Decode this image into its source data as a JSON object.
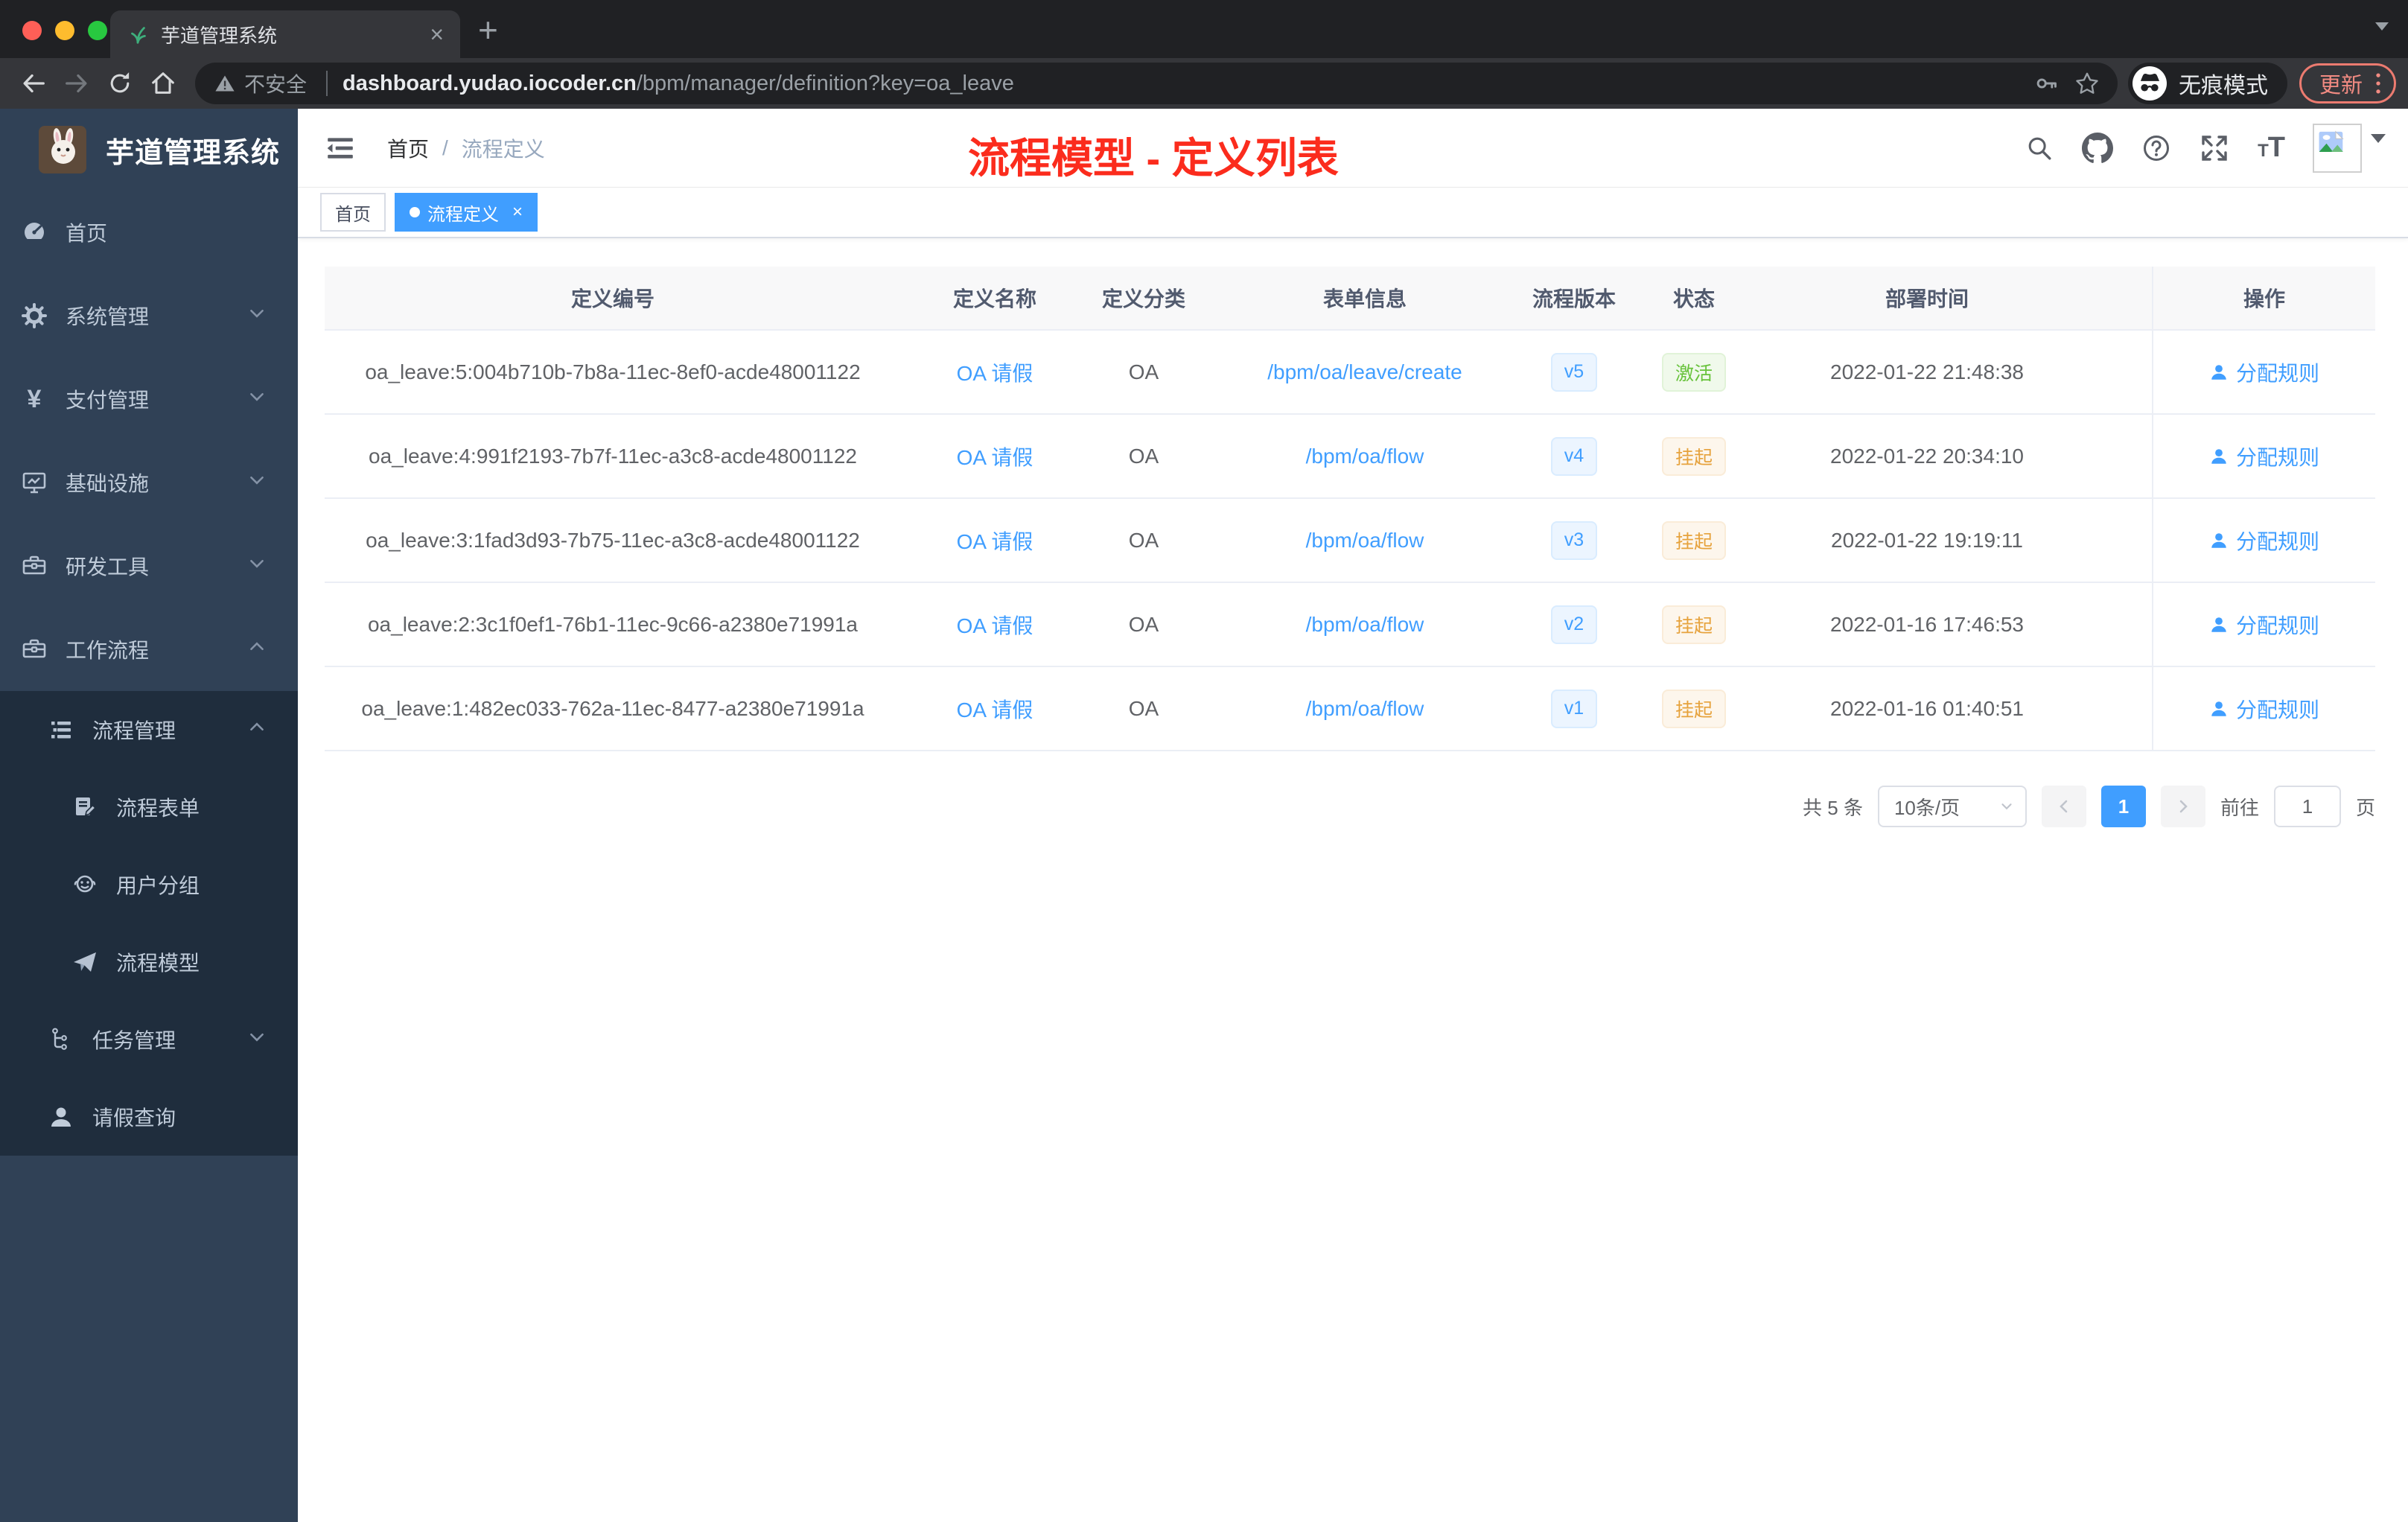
{
  "browser": {
    "tab_title": "芋道管理系统",
    "tab_close": "×",
    "new_tab": "+",
    "security_label": "不安全",
    "url_host": "dashboard.yudao.iocoder.cn",
    "url_path": "/bpm/manager/definition?key=oa_leave",
    "incognito_label": "无痕模式",
    "update_label": "更新"
  },
  "sidebar": {
    "app_title": "芋道管理系统",
    "menu": [
      {
        "label": "首页",
        "icon": "dashboard-icon",
        "arrow": "none"
      },
      {
        "label": "系统管理",
        "icon": "gear-icon",
        "arrow": "down"
      },
      {
        "label": "支付管理",
        "icon": "yen-icon",
        "arrow": "down"
      },
      {
        "label": "基础设施",
        "icon": "monitor-icon",
        "arrow": "down"
      },
      {
        "label": "研发工具",
        "icon": "toolbox-icon",
        "arrow": "down"
      },
      {
        "label": "工作流程",
        "icon": "briefcase-icon",
        "arrow": "up"
      }
    ],
    "submenu": [
      {
        "label": "流程管理",
        "icon": "list-tree-icon",
        "arrow": "up",
        "level": 1
      },
      {
        "label": "流程表单",
        "icon": "form-edit-icon",
        "level": 2
      },
      {
        "label": "用户分组",
        "icon": "user-group-icon",
        "level": 2
      },
      {
        "label": "流程模型",
        "icon": "paper-plane-icon",
        "level": 2
      },
      {
        "label": "任务管理",
        "icon": "task-tree-icon",
        "arrow": "down",
        "level": 1
      },
      {
        "label": "请假查询",
        "icon": "user-icon",
        "level": 1
      }
    ]
  },
  "header": {
    "breadcrumb": {
      "home": "首页",
      "separator": "/",
      "current": "流程定义"
    }
  },
  "annotation": {
    "text": "流程模型 - 定义列表",
    "color": "#fb2c1d"
  },
  "tags": {
    "home": {
      "label": "首页"
    },
    "current": {
      "label": "流程定义",
      "close": "×"
    }
  },
  "table": {
    "columns": {
      "id": "定义编号",
      "name": "定义名称",
      "category": "定义分类",
      "form": "表单信息",
      "version": "流程版本",
      "status": "状态",
      "deploy_time": "部署时间",
      "action": "操作"
    },
    "rows": [
      {
        "id": "oa_leave:5:004b710b-7b8a-11ec-8ef0-acde48001122",
        "name": "OA 请假",
        "category": "OA",
        "form": "/bpm/oa/leave/create",
        "version": "v5",
        "status": "激活",
        "badge_class": "badge badge-success",
        "time": "2022-01-22 21:48:38",
        "action": "分配规则"
      },
      {
        "id": "oa_leave:4:991f2193-7b7f-11ec-a3c8-acde48001122",
        "name": "OA 请假",
        "category": "OA",
        "form": "/bpm/oa/flow",
        "version": "v4",
        "status": "挂起",
        "badge_class": "badge badge-warning",
        "time": "2022-01-22 20:34:10",
        "action": "分配规则"
      },
      {
        "id": "oa_leave:3:1fad3d93-7b75-11ec-a3c8-acde48001122",
        "name": "OA 请假",
        "category": "OA",
        "form": "/bpm/oa/flow",
        "version": "v3",
        "status": "挂起",
        "badge_class": "badge badge-warning",
        "time": "2022-01-22 19:19:11",
        "action": "分配规则"
      },
      {
        "id": "oa_leave:2:3c1f0ef1-76b1-11ec-9c66-a2380e71991a",
        "name": "OA 请假",
        "category": "OA",
        "form": "/bpm/oa/flow",
        "version": "v2",
        "status": "挂起",
        "badge_class": "badge badge-warning",
        "time": "2022-01-16 17:46:53",
        "action": "分配规则"
      },
      {
        "id": "oa_leave:1:482ec033-762a-11ec-8477-a2380e71991a",
        "name": "OA 请假",
        "category": "OA",
        "form": "/bpm/oa/flow",
        "version": "v1",
        "status": "挂起",
        "badge_class": "badge badge-warning",
        "time": "2022-01-16 01:40:51",
        "action": "分配规则"
      }
    ]
  },
  "pagination": {
    "total": "共 5 条",
    "page_size": "10条/页",
    "current_page": "1",
    "goto_label": "前往",
    "goto_value": "1",
    "page_suffix": "页"
  },
  "colors": {
    "primary": "#409eff",
    "success": "#67c23a",
    "warning": "#e6a23c",
    "annotation_red": "#fb2c1d",
    "sidebar_bg": "#304156",
    "submenu_bg": "#1f2d3d",
    "chrome_dark": "#202124",
    "chrome_toolbar": "#35363a"
  }
}
